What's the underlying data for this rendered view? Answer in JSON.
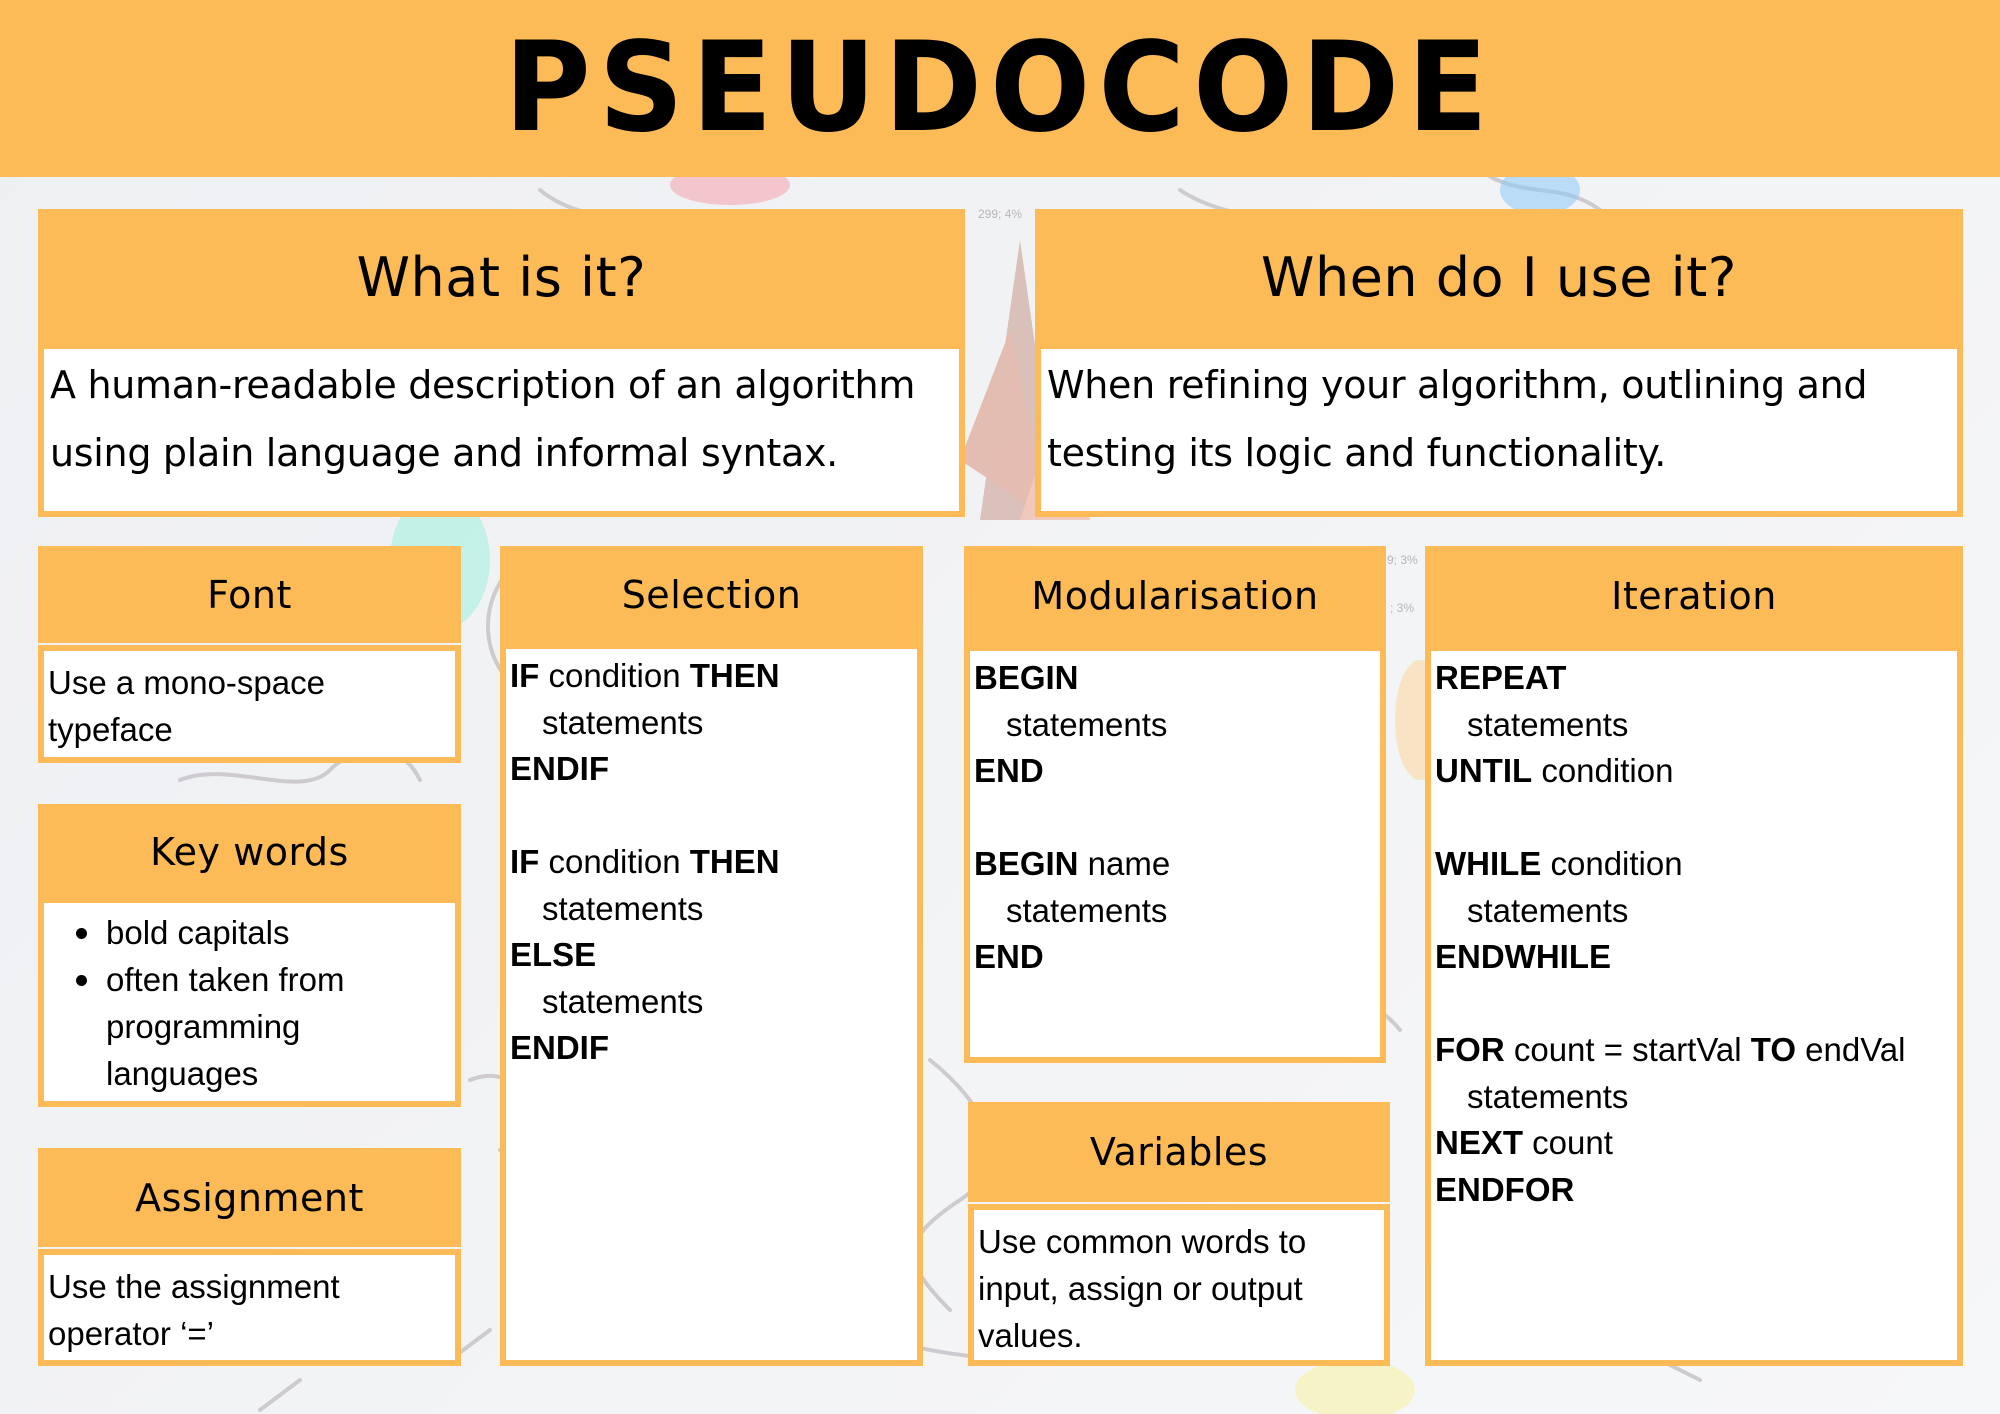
{
  "header": {
    "title": "PSEUDOCODE"
  },
  "colors": {
    "accent": "#FDBB57",
    "card_body": "#FFFFFF",
    "background": "#F0F1F3",
    "text": "#000000"
  },
  "top_cards": [
    {
      "heading": "What is it?",
      "lines": [
        "A human-readable description of an algorithm",
        "using plain language and informal syntax."
      ]
    },
    {
      "heading": "When do I use it?",
      "lines": [
        "When refining your algorithm, outlining and",
        "testing its logic and functionality."
      ]
    }
  ],
  "font_card": {
    "heading": "Font",
    "lines": [
      "Use a mono-space",
      "typeface"
    ]
  },
  "keywords_card": {
    "heading": "Key words",
    "bullets": [
      {
        "lines": [
          "bold capitals"
        ]
      },
      {
        "lines": [
          "often taken from",
          "programming",
          "languages"
        ]
      }
    ]
  },
  "assignment_card": {
    "heading": "Assignment",
    "lines": [
      "Use the assignment",
      "operator ‘=’"
    ]
  },
  "selection_card": {
    "heading": "Selection",
    "code": [
      {
        "indent": false,
        "parts": [
          {
            "t": "IF",
            "b": true
          },
          {
            "t": " condition ",
            "b": false
          },
          {
            "t": "THEN",
            "b": true
          }
        ]
      },
      {
        "indent": true,
        "parts": [
          {
            "t": "statements",
            "b": false
          }
        ]
      },
      {
        "indent": false,
        "parts": [
          {
            "t": "ENDIF",
            "b": true
          }
        ]
      },
      {
        "indent": false,
        "parts": [
          {
            "t": " ",
            "b": false
          }
        ]
      },
      {
        "indent": false,
        "parts": [
          {
            "t": "IF",
            "b": true
          },
          {
            "t": " condition ",
            "b": false
          },
          {
            "t": "THEN",
            "b": true
          }
        ]
      },
      {
        "indent": true,
        "parts": [
          {
            "t": "statements",
            "b": false
          }
        ]
      },
      {
        "indent": false,
        "parts": [
          {
            "t": "ELSE",
            "b": true
          }
        ]
      },
      {
        "indent": true,
        "parts": [
          {
            "t": "statements",
            "b": false
          }
        ]
      },
      {
        "indent": false,
        "parts": [
          {
            "t": "ENDIF",
            "b": true
          }
        ]
      }
    ]
  },
  "modularisation_card": {
    "heading": "Modularisation",
    "code": [
      {
        "indent": false,
        "parts": [
          {
            "t": "BEGIN",
            "b": true
          }
        ]
      },
      {
        "indent": true,
        "parts": [
          {
            "t": "statements",
            "b": false
          }
        ]
      },
      {
        "indent": false,
        "parts": [
          {
            "t": "END",
            "b": true
          }
        ]
      },
      {
        "indent": false,
        "parts": [
          {
            "t": " ",
            "b": false
          }
        ]
      },
      {
        "indent": false,
        "parts": [
          {
            "t": "BEGIN",
            "b": true
          },
          {
            "t": " name",
            "b": false
          }
        ]
      },
      {
        "indent": true,
        "parts": [
          {
            "t": "statements",
            "b": false
          }
        ]
      },
      {
        "indent": false,
        "parts": [
          {
            "t": "END",
            "b": true
          }
        ]
      }
    ]
  },
  "variables_card": {
    "heading": "Variables",
    "lines": [
      "Use common words to",
      "input, assign or output",
      "values."
    ]
  },
  "iteration_card": {
    "heading": "Iteration",
    "code": [
      {
        "indent": false,
        "parts": [
          {
            "t": "REPEAT",
            "b": true
          }
        ]
      },
      {
        "indent": true,
        "parts": [
          {
            "t": "statements",
            "b": false
          }
        ]
      },
      {
        "indent": false,
        "parts": [
          {
            "t": "UNTIL",
            "b": true
          },
          {
            "t": " condition",
            "b": false
          }
        ]
      },
      {
        "indent": false,
        "parts": [
          {
            "t": " ",
            "b": false
          }
        ]
      },
      {
        "indent": false,
        "parts": [
          {
            "t": "WHILE",
            "b": true
          },
          {
            "t": " condition",
            "b": false
          }
        ]
      },
      {
        "indent": true,
        "parts": [
          {
            "t": "statements",
            "b": false
          }
        ]
      },
      {
        "indent": false,
        "parts": [
          {
            "t": "ENDWHILE",
            "b": true
          }
        ]
      },
      {
        "indent": false,
        "parts": [
          {
            "t": " ",
            "b": false
          }
        ]
      },
      {
        "indent": false,
        "parts": [
          {
            "t": "FOR",
            "b": true
          },
          {
            "t": " count = startVal ",
            "b": false
          },
          {
            "t": "TO",
            "b": true
          },
          {
            "t": " endVal",
            "b": false
          }
        ]
      },
      {
        "indent": true,
        "parts": [
          {
            "t": "statements",
            "b": false
          }
        ]
      },
      {
        "indent": false,
        "parts": [
          {
            "t": "NEXT",
            "b": true
          },
          {
            "t": " count",
            "b": false
          }
        ]
      },
      {
        "indent": false,
        "parts": [
          {
            "t": "ENDFOR",
            "b": true
          }
        ]
      }
    ]
  },
  "background_labels": [
    "299; 4%",
    "9; 3%",
    "; 3%"
  ]
}
